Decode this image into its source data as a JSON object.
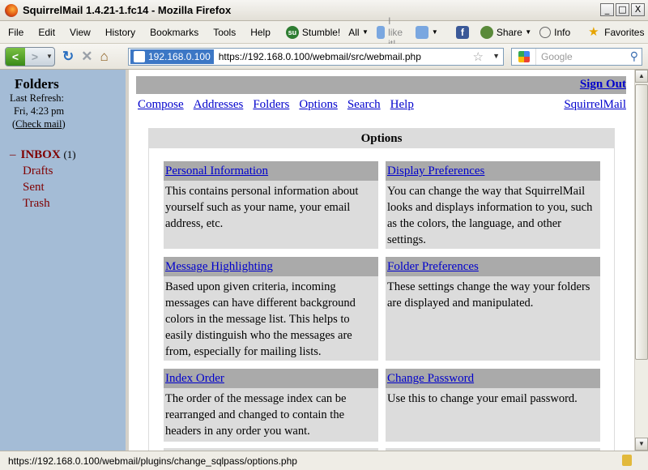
{
  "window": {
    "title": "SquirrelMail 1.4.21-1.fc14 - Mozilla Firefox",
    "minimize": "_",
    "maximize": "□",
    "close": "X"
  },
  "menu": [
    "File",
    "Edit",
    "View",
    "History",
    "Bookmarks",
    "Tools",
    "Help"
  ],
  "toolbar": {
    "stumble": "Stumble!",
    "all": "All",
    "like": "I like it!",
    "share": "Share",
    "info": "Info",
    "favorites": "Favorites"
  },
  "nav": {
    "identity": "192.168.0.100",
    "url": "https://192.168.0.100/webmail/src/webmail.php",
    "search_placeholder": "Google"
  },
  "left": {
    "title": "Folders",
    "last_refresh_label": "Last Refresh:",
    "time": "Fri, 4:23 pm",
    "check_mail_open": "(",
    "check_mail": "Check mail",
    "check_mail_close": ")",
    "inbox_toggle": "–",
    "inbox": "INBOX",
    "inbox_count": "(1)",
    "folders": [
      "Drafts",
      "Sent",
      "Trash"
    ]
  },
  "top": {
    "sign_out": "Sign Out",
    "links": [
      "Compose",
      "Addresses",
      "Folders",
      "Options",
      "Search",
      "Help"
    ],
    "squirrelmail": "SquirrelMail"
  },
  "options": {
    "heading": "Options",
    "items": [
      {
        "title": "Personal Information",
        "desc": "This contains personal information about yourself such as your name, your email address, etc."
      },
      {
        "title": "Display Preferences",
        "desc": "You can change the way that SquirrelMail looks and displays information to you, such as the colors, the language, and other settings."
      },
      {
        "title": "Message Highlighting",
        "desc": "Based upon given criteria, incoming messages can have different background colors in the message list. This helps to easily distinguish who the messages are from, especially for mailing lists."
      },
      {
        "title": "Folder Preferences",
        "desc": "These settings change the way your folders are displayed and manipulated."
      },
      {
        "title": "Index Order",
        "desc": "The order of the message index can be rearranged and changed to contain the headers in any order you want."
      },
      {
        "title": "Change Password",
        "desc": "Use this to change your email password."
      }
    ]
  },
  "status": {
    "text": "https://192.168.0.100/webmail/plugins/change_sqlpass/options.php"
  }
}
